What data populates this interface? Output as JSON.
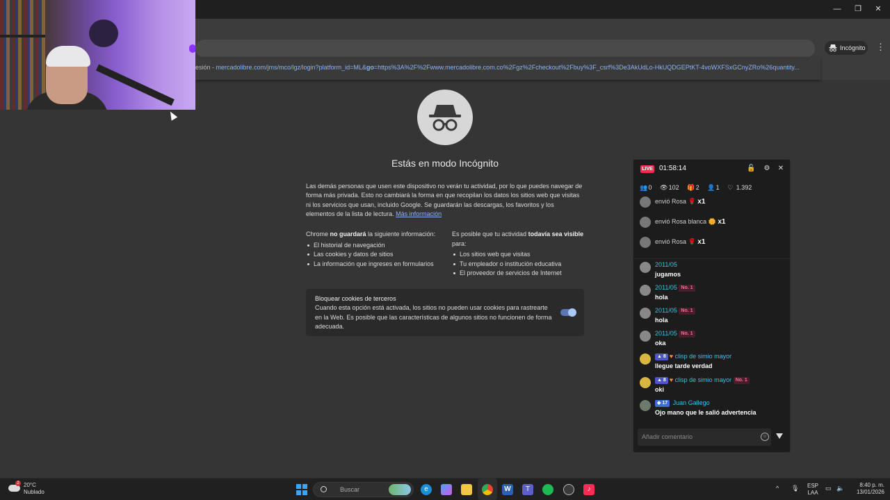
{
  "window": {
    "minimize": "—",
    "restore": "❐",
    "close": "✕"
  },
  "toolbar": {
    "incognito_label": "Incógnito",
    "menu": "⋮"
  },
  "omnibox": {
    "suggestion_prefix": "esión - ",
    "suggestion_url_a": "mercadolibre.com/jms/mco/lgz/login?platform_id=ML&",
    "suggestion_url_bold": "go",
    "suggestion_url_b": "=https%3A%2F%2Fwww.mercadolibre.com.co%2Fgz%2Fcheckout%2Fbuy%3F_csrf%3De3AkUdLo-HkUQDGEPtKT-4voWXFSxGCnyZRo%26quantity..."
  },
  "incognito_page": {
    "title": "Estás en modo Incógnito",
    "intro": "Las demás personas que usen este dispositivo no verán tu actividad, por lo que puedes navegar de forma más privada. Esto no cambiará la forma en que recopilan los datos los sitios web que visitas ni los servicios que usan, incluido Google. Se guardarán las descargas, los favoritos y los elementos de la lista de lectura.",
    "learn_more": "Más información",
    "left_col": {
      "lead_a": "Chrome ",
      "lead_bold": "no guardará",
      "lead_b": " la siguiente información:",
      "items": [
        "El historial de navegación",
        "Las cookies y datos de sitios",
        "La información que ingreses en formularios"
      ]
    },
    "right_col": {
      "lead_a": "Es posible que tu actividad ",
      "lead_bold": "todavía sea visible",
      "lead_b": " para:",
      "items": [
        "Los sitios web que visitas",
        "Tu empleador o institución educativa",
        "El proveedor de servicios de Internet"
      ]
    },
    "cookies": {
      "heading": "Bloquear cookies de terceros",
      "description": "Cuando esta opción está activada, los sitios no pueden usar cookies para rastrearte en la Web. Es posible que las características de algunos sitios no funcionen de forma adecuada.",
      "enabled": true
    }
  },
  "live_panel": {
    "live_badge": "LIVE",
    "timer": "01:58:14",
    "stats": [
      "0",
      "102",
      "2",
      "1",
      "1.392"
    ],
    "gifts": [
      {
        "text": "envió Rosa",
        "count": "x1"
      },
      {
        "text": "envió Rosa blanca",
        "count": "x1"
      },
      {
        "text": "envió Rosa",
        "count": "x1"
      }
    ],
    "messages": [
      {
        "name": "2011/05",
        "badge": "",
        "text": "jugamos"
      },
      {
        "name": "2011/05",
        "badge": "No. 1",
        "text": "hola"
      },
      {
        "name": "2011/05",
        "badge": "No. 1",
        "text": "hola"
      },
      {
        "name": "2011/05",
        "badge": "No. 1",
        "text": "oka"
      },
      {
        "level": "8",
        "name": "clisp de simio mayor",
        "badge": "",
        "text": "llegue tarde verdad"
      },
      {
        "level": "8",
        "name": "clisp de simio mayor",
        "badge": "No. 1",
        "text": "oki"
      },
      {
        "level": "17",
        "name": "Juan Gallego",
        "badge": "",
        "text": "Ojo mano que le salió advertencia"
      }
    ],
    "comment_placeholder": "Añadir comentario"
  },
  "taskbar": {
    "weather_temp": "20°C",
    "weather_desc": "Nublado",
    "weather_badge": "2",
    "search_placeholder": "Buscar",
    "lang_top": "ESP",
    "lang_bottom": "LAA",
    "time": "8:40 p. m.",
    "date": "13/01/2026",
    "icons": [
      "windows-start",
      "search",
      "edge",
      "copilot",
      "file-explorer",
      "chrome",
      "word",
      "teams",
      "spotify",
      "steam",
      "tiktok-live"
    ]
  }
}
